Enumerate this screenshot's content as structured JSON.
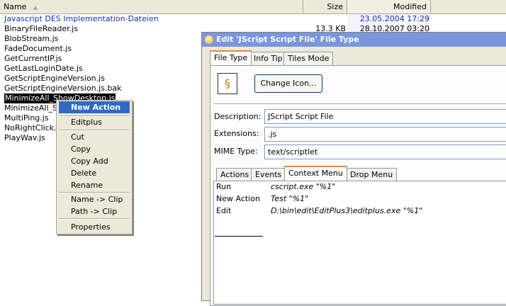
{
  "columns": {
    "name": "Name",
    "size": "Size",
    "modified": "Modified"
  },
  "files": [
    {
      "name": "Javascript DES Implementation-Dateien",
      "size": "",
      "modified": "23.05.2004  17:29",
      "folder": true
    },
    {
      "name": "BinaryFileReader.js",
      "size": "13.3 KB",
      "modified": "28.10.2007  03:20"
    },
    {
      "name": "BlobStream.js",
      "size": "",
      "modified": ""
    },
    {
      "name": "FadeDocument.js",
      "size": "",
      "modified": ""
    },
    {
      "name": "GetCurrentIP.js",
      "size": "",
      "modified": ""
    },
    {
      "name": "GetLastLoginDate.js",
      "size": "",
      "modified": ""
    },
    {
      "name": "GetScriptEngineVersion.js",
      "size": "",
      "modified": ""
    },
    {
      "name": "GetScriptEngineVersion.js.bak",
      "size": "",
      "modified": ""
    },
    {
      "name": "MinimizeAll_ShowDesktop.js",
      "size": "",
      "modified": "",
      "selected": true
    },
    {
      "name": "MinimizeAll_Sho",
      "size": "",
      "modified": ""
    },
    {
      "name": "MultiPing.js",
      "size": "",
      "modified": ""
    },
    {
      "name": "NoRightClick.js",
      "size": "",
      "modified": ""
    },
    {
      "name": "PlayWav.js",
      "size": "",
      "modified": ""
    }
  ],
  "context_menu": {
    "items": [
      "New Action",
      "Editplus",
      "Cut",
      "Copy",
      "Copy Add",
      "Delete",
      "Rename",
      "Name -> Clip",
      "Path -> Clip",
      "Properties"
    ]
  },
  "dialog": {
    "title": "Edit 'JScript Script File' File Type",
    "tabs": [
      "File Type",
      "Info Tip",
      "Tiles Mode"
    ],
    "change_icon_label": "Change Icon...",
    "description_label": "Description:",
    "description_value": "JScript Script File",
    "extensions_label": "Extensions:",
    "extensions_value": ".js",
    "mime_label": "MIME Type:",
    "mime_value": "text/scriptlet",
    "subtabs": [
      "Actions",
      "Events",
      "Context Menu",
      "Drop Menu"
    ],
    "actions": [
      {
        "name": "Run",
        "command": "cscript.exe \"%1\""
      },
      {
        "name": "New Action",
        "command": "Test \"%1\""
      },
      {
        "name": "Edit",
        "command": "D:\\bin\\edit\\EditPlus3\\editplus.exe \"%1\""
      }
    ]
  },
  "colors": {
    "menu_highlight": "#316ac5",
    "folder_text": "#1c2bb8",
    "titlebar": "#7a96df",
    "active_tab_accent": "#e68b2c"
  }
}
